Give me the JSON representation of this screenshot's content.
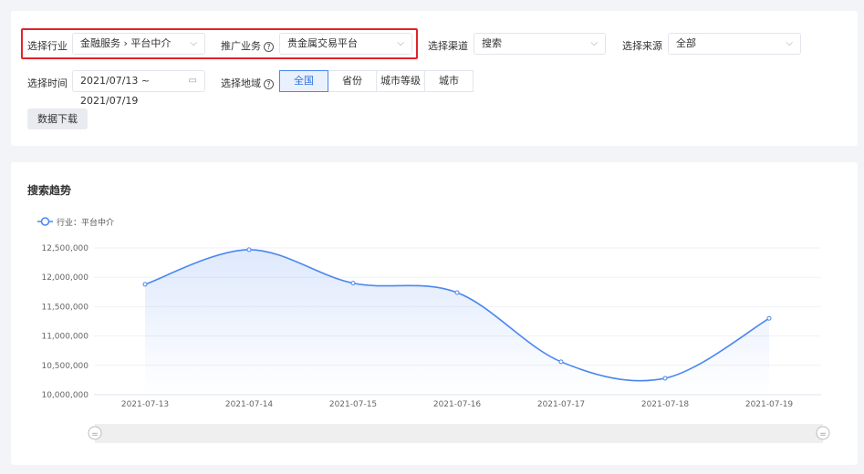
{
  "filters": {
    "industry": {
      "label": "选择行业",
      "value": "金融服务 › 平台中介"
    },
    "business": {
      "label": "推广业务",
      "help": "?",
      "value": "贵金属交易平台"
    },
    "channel": {
      "label": "选择渠道",
      "value": "搜索"
    },
    "source": {
      "label": "选择来源",
      "value": "全部"
    },
    "time": {
      "label": "选择时间",
      "value": "2021/07/13 ~ 2021/07/19"
    },
    "region": {
      "label": "选择地域",
      "help": "?",
      "options": [
        "全国",
        "省份",
        "城市等级",
        "城市"
      ],
      "selected": "全国"
    },
    "download_label": "数据下载"
  },
  "colors": {
    "accent": "#4a86f0",
    "highlight": "#e0242b"
  },
  "chart_data": {
    "type": "area",
    "title": "搜索趋势",
    "legend": {
      "position": "top-left"
    },
    "series": [
      {
        "name": "行业：平台中介",
        "values": [
          11880000,
          12470000,
          11900000,
          11740000,
          10560000,
          10280000,
          11300000
        ]
      }
    ],
    "categories": [
      "2021-07-13",
      "2021-07-14",
      "2021-07-15",
      "2021-07-16",
      "2021-07-17",
      "2021-07-18",
      "2021-07-19"
    ],
    "ylim": [
      10000000,
      12500000
    ],
    "yticks": [
      "10,000,000",
      "10,500,000",
      "11,000,000",
      "11,500,000",
      "12,000,000",
      "12,500,000"
    ],
    "grid": true,
    "smooth": true,
    "datazoom": true
  }
}
